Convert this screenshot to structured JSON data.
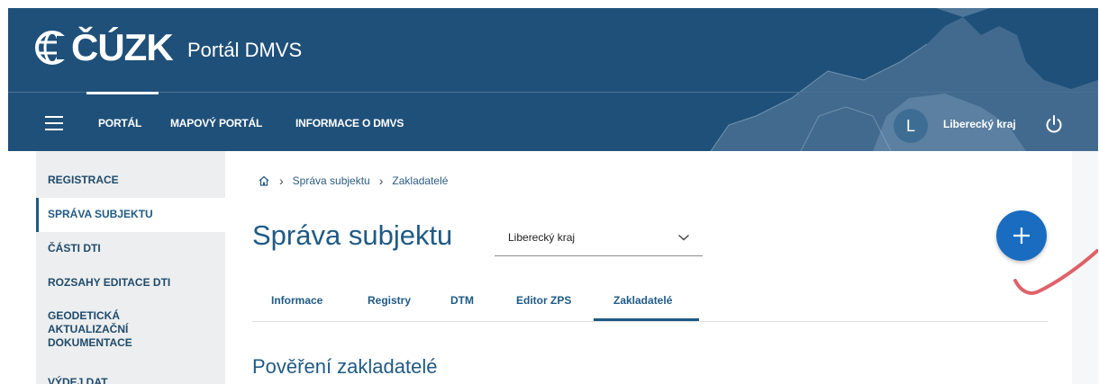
{
  "header": {
    "logo_text": "ČÚZK",
    "app_title": "Portál DMVS",
    "menu_icon": "hamburger-menu-icon",
    "nav": [
      "PORTÁL",
      "MAPOVÝ PORTÁL",
      "INFORMACE O DMVS"
    ],
    "user": {
      "initial": "L",
      "name": "Liberecký kraj"
    },
    "power_icon": "power-icon"
  },
  "sidebar": {
    "items": [
      {
        "label": "REGISTRACE"
      },
      {
        "label": "SPRÁVA SUBJEKTU"
      },
      {
        "label": "ČÁSTI DTI"
      },
      {
        "label": "ROZSAHY EDITACE DTI"
      },
      {
        "label": "GEODETICKÁ AKTUALIZAČNÍ DOKUMENTACE"
      },
      {
        "label": "VÝDEJ DAT"
      }
    ]
  },
  "breadcrumb": {
    "home_icon": "home-icon",
    "items": [
      "Správa subjektu",
      "Zakladatelé"
    ]
  },
  "page_title": "Správa subjektu",
  "region_select": {
    "value": "Liberecký kraj",
    "icon": "chevron-down-icon"
  },
  "add_button": {
    "icon": "plus-icon"
  },
  "tabs": [
    "Informace",
    "Registry",
    "DTM",
    "Editor ZPS",
    "Zakladatelé"
  ],
  "section_title": "Pověření zakladatelé",
  "colors": {
    "header_bg": "#1f5079",
    "primary": "#1f5a85",
    "fab": "#1a6cc0",
    "sidebar_bg": "#eceeef"
  }
}
